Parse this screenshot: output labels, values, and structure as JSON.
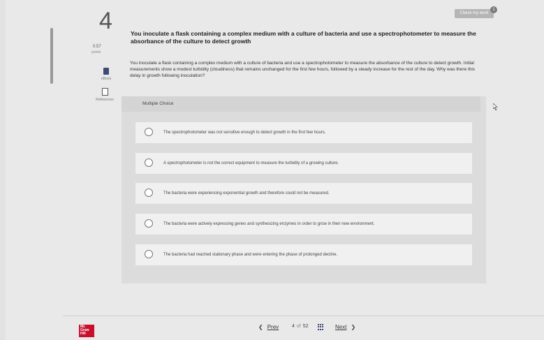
{
  "header": {
    "check_button": "Check my work",
    "check_badge": "1"
  },
  "question": {
    "number": "4",
    "title": "You inoculate a flask containing a complex medium with a culture of bacteria and use a spectrophotometer to measure the absorbance of the culture to detect growth",
    "points_value": "0.57",
    "points_label": "points",
    "body": "You inoculate a flask containing a complex medium with a culture of bacteria and use a spectrophotometer to measure the absorbance of the culture to detect growth. Initial measurements show a modest turbidity (cloudiness) that remains unchanged for the first few hours, followed by a steady increase for the rest of the day. Why was there this delay in growth following inoculation?"
  },
  "sidebar": {
    "ebook_label": "eBook",
    "references_label": "References"
  },
  "multiple_choice": {
    "header": "Multiple Choice",
    "options": [
      {
        "text": "The spectrophotometer was not sensitive enough to detect growth in the first few hours."
      },
      {
        "text": "A spectrophotometer is not the correct equipment to measure the turbidity of a growing culture."
      },
      {
        "text": "The bacteria were experiencing exponential growth and therefore could not be measured."
      },
      {
        "text": "The bacteria were actively expressing genes and synthesizing enzymes in order to grow in their new environment."
      },
      {
        "text": "The bacteria had reached stationary phase and were entering the phase of prolonged decline."
      }
    ]
  },
  "footer": {
    "logo_lines": [
      "Mc",
      "Graw",
      "Hill"
    ],
    "prev_label": "Prev",
    "current": "4",
    "of_label": "of",
    "total": "52",
    "next_label": "Next"
  },
  "icons": {
    "ebook": "book-icon",
    "references": "document-icon",
    "pager": "grid-icon",
    "prev": "chevron-left-icon",
    "next": "chevron-right-icon"
  }
}
